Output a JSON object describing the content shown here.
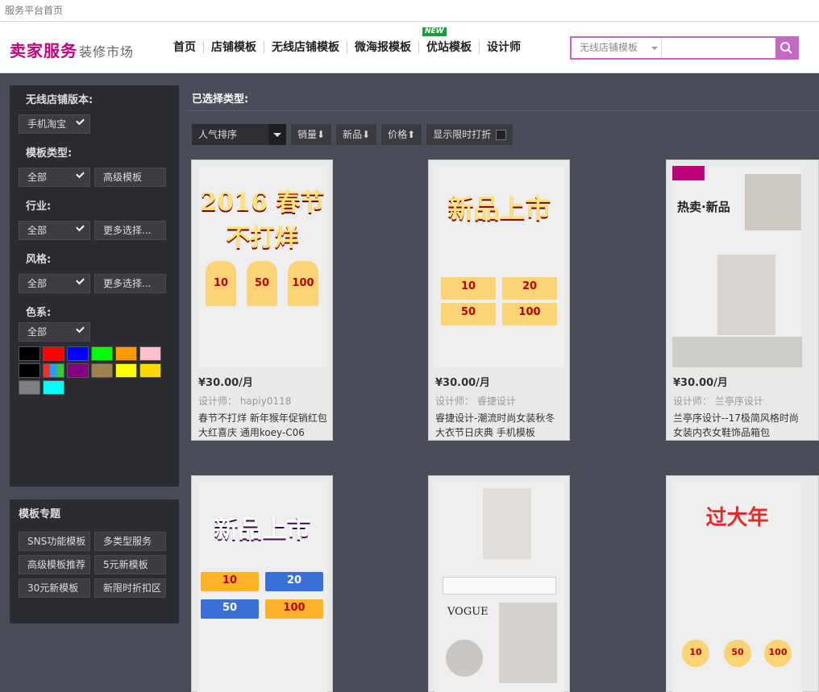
{
  "topbar": {
    "title": "服务平台首页"
  },
  "header": {
    "logo_main": "卖家服务",
    "logo_sub": "装修市场",
    "nav": [
      {
        "label": "首页"
      },
      {
        "label": "店铺模板"
      },
      {
        "label": "无线店铺模板",
        "active": true
      },
      {
        "label": "微海报模板"
      },
      {
        "label": "优站模板",
        "badge": "NEW"
      },
      {
        "label": "设计师"
      }
    ],
    "search_category": "无线店铺模板",
    "search_placeholder": ""
  },
  "sidebar": {
    "version_title": "无线店铺版本:",
    "version_value": "手机淘宝",
    "type_title": "模板类型:",
    "type_all": "全部",
    "type_adv": "高级模板",
    "industry_title": "行业:",
    "industry_all": "全部",
    "industry_more": "更多选择...",
    "style_title": "风格:",
    "style_all": "全部",
    "style_more": "更多选择...",
    "color_title": "色系:",
    "color_all": "全部",
    "colors": [
      "#000000",
      "#ff0000",
      "#0000ff",
      "#00ff00",
      "#ff9900",
      "#ffc0cb",
      "#000000",
      "multi",
      "#800080",
      "#a0824f",
      "#ffff00",
      "#ffd700",
      "#808080",
      "#00ffff"
    ]
  },
  "special": {
    "title": "模板专题",
    "items": [
      "SNS功能模板",
      "多类型服务",
      "高级模板推荐",
      "5元新模板",
      "30元新模板",
      "新限时折扣区"
    ]
  },
  "content": {
    "selected_label": "已选择类型:",
    "sort_selected": "人气排序",
    "sort_sales": "销量⬇",
    "sort_new": "新品⬇",
    "sort_price": "价格⬆",
    "sort_discount": "显示限时打折"
  },
  "cards": [
    {
      "price": "¥30.00/月",
      "designer": "设计师： hapiy0118",
      "desc": "春节不打烊 新年猴年促销红包大红喜庆 通用koey-C06",
      "img_text": "2016 春节不打烊"
    },
    {
      "price": "¥30.00/月",
      "designer": "设计师： 睿捷设计",
      "desc": "睿捷设计-潮流时尚女装秋冬大衣节日庆典 手机模板",
      "img_text": "新品上市"
    },
    {
      "price": "¥30.00/月",
      "designer": "设计师： 兰亭序设计",
      "desc": "兰亭序设计--17极简风格时尚女装内衣女鞋饰品箱包",
      "img_text": "热卖·新品"
    },
    {
      "img_text": "新品上市"
    },
    {
      "img_text": "VOGUE"
    },
    {
      "img_text": "过大年"
    }
  ]
}
